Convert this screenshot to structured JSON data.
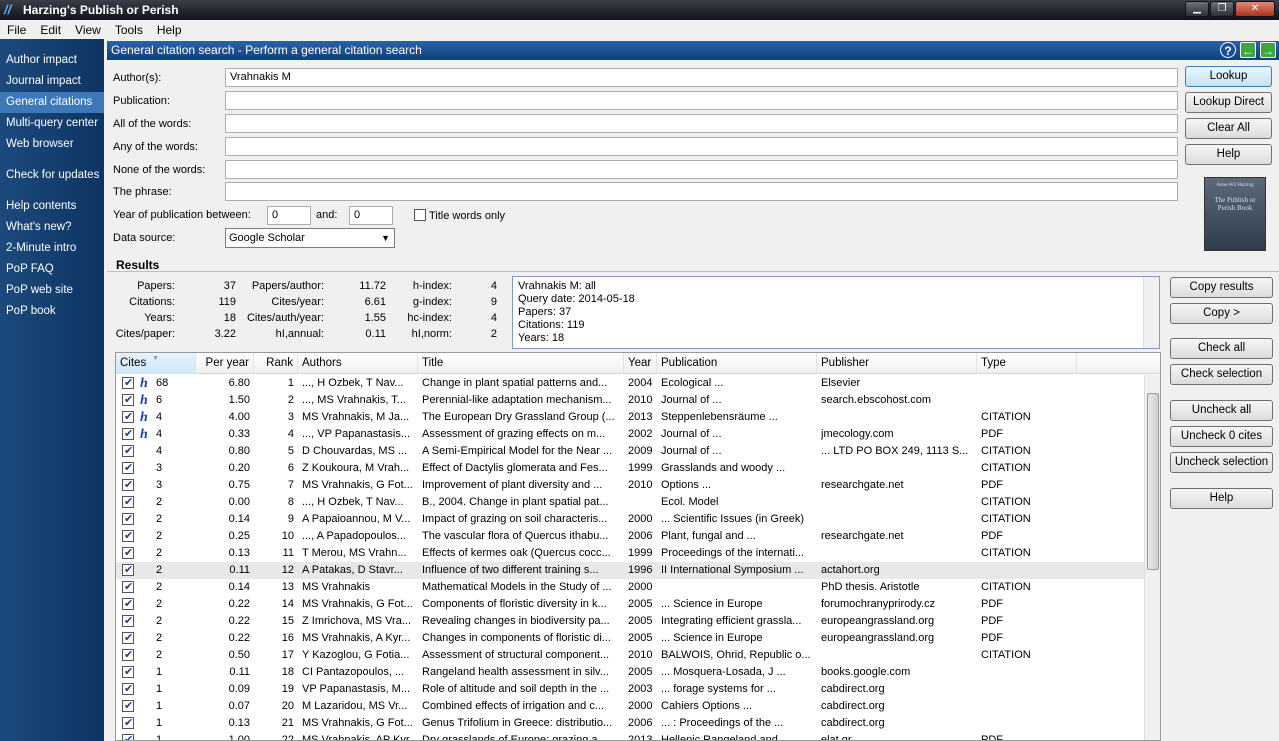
{
  "window": {
    "title": "Harzing's Publish or Perish",
    "min": "▁",
    "max": "❐",
    "close": "✕"
  },
  "menu": [
    "File",
    "Edit",
    "View",
    "Tools",
    "Help"
  ],
  "sidebar": {
    "items": [
      "Author impact",
      "Journal impact",
      "General citations",
      "Multi-query center",
      "Web browser"
    ],
    "updates": "Check for updates",
    "help_items": [
      "Help contents",
      "What's new?",
      "2-Minute intro",
      "PoP FAQ",
      "PoP web site",
      "PoP book"
    ]
  },
  "panel": {
    "title": "General citation search - Perform a general citation search"
  },
  "form": {
    "authors_label": "Author(s):",
    "authors_value": "Vrahnakis M",
    "publication_label": "Publication:",
    "publication_value": "",
    "all_words_label": "All of the words:",
    "all_words_value": "",
    "any_words_label": "Any of the words:",
    "any_words_value": "",
    "none_words_label": "None of the words:",
    "none_words_value": "",
    "phrase_label": "The phrase:",
    "phrase_value": "",
    "year_label": "Year of publication between:",
    "year_from": "0",
    "and_label": "and:",
    "year_to": "0",
    "title_only_label": "Title words only",
    "source_label": "Data source:",
    "source_value": "Google Scholar"
  },
  "buttons": {
    "lookup": "Lookup",
    "lookup_direct": "Lookup Direct",
    "clear_all": "Clear All",
    "help": "Help",
    "copy_results": "Copy results",
    "copy_more": "Copy >",
    "check_all": "Check all",
    "check_selection": "Check selection",
    "uncheck_all": "Uncheck all",
    "uncheck_zero": "Uncheck 0 cites",
    "uncheck_selection": "Uncheck selection",
    "help2": "Help"
  },
  "book": {
    "author": "Anne-Wil Harzing",
    "title": "The Publish or Perish Book"
  },
  "results": {
    "label": "Results",
    "metrics": [
      [
        "Papers:",
        "37",
        "Papers/author:",
        "11.72",
        "h-index:",
        "4"
      ],
      [
        "Citations:",
        "119",
        "Cites/year:",
        "6.61",
        "g-index:",
        "9"
      ],
      [
        "Years:",
        "18",
        "Cites/auth/year:",
        "1.55",
        "hc-index:",
        "4"
      ],
      [
        "Cites/paper:",
        "3.22",
        "hI,annual:",
        "0.11",
        "hI,norm:",
        "2"
      ]
    ],
    "notes": [
      "Vrahnakis M: all",
      "Query date: 2014-05-18",
      "Papers: 37",
      "Citations: 119",
      "Years: 18"
    ]
  },
  "table": {
    "headers": [
      "Cites",
      "Per year",
      "Rank",
      "Authors",
      "Title",
      "Year",
      "Publication",
      "Publisher",
      "Type"
    ],
    "rows": [
      {
        "h": true,
        "cites": "68",
        "per_year": "6.80",
        "rank": "1",
        "authors": "..., H Ozbek, T Nav...",
        "title": "Change in plant spatial patterns and...",
        "year": "2004",
        "publication": "Ecological ...",
        "publisher": "Elsevier",
        "type": ""
      },
      {
        "h": true,
        "cites": "6",
        "per_year": "1.50",
        "rank": "2",
        "authors": "..., MS Vrahnakis, T...",
        "title": "Perennial-like adaptation mechanism...",
        "year": "2010",
        "publication": "Journal of ...",
        "publisher": "search.ebscohost.com",
        "type": ""
      },
      {
        "h": true,
        "cites": "4",
        "per_year": "4.00",
        "rank": "3",
        "authors": "MS Vrahnakis, M Ja...",
        "title": "The European Dry Grassland Group (...",
        "year": "2013",
        "publication": "Steppenlebensräume ...",
        "publisher": "",
        "type": "CITATION"
      },
      {
        "h": true,
        "cites": "4",
        "per_year": "0.33",
        "rank": "4",
        "authors": "..., VP Papanastasis...",
        "title": "Assessment of grazing effects on m...",
        "year": "2002",
        "publication": "Journal of ...",
        "publisher": "jmecology.com",
        "type": "PDF"
      },
      {
        "h": false,
        "cites": "4",
        "per_year": "0.80",
        "rank": "5",
        "authors": "D Chouvardas, MS ...",
        "title": "A Semi-Empirical Model for the Near ...",
        "year": "2009",
        "publication": "Journal of ...",
        "publisher": "... LTD PO BOX 249, 1113 S...",
        "type": "CITATION"
      },
      {
        "h": false,
        "cites": "3",
        "per_year": "0.20",
        "rank": "6",
        "authors": "Z Koukoura, M Vrah...",
        "title": "Effect of Dactylis glomerata and Fes...",
        "year": "1999",
        "publication": "Grasslands and woody ...",
        "publisher": "",
        "type": "CITATION"
      },
      {
        "h": false,
        "cites": "3",
        "per_year": "0.75",
        "rank": "7",
        "authors": "MS Vrahnakis, G Fot...",
        "title": "Improvement of plant diversity and ...",
        "year": "2010",
        "publication": "Options ...",
        "publisher": "researchgate.net",
        "type": "PDF"
      },
      {
        "h": false,
        "cites": "2",
        "per_year": "0.00",
        "rank": "8",
        "authors": "..., H Ozbek, T Nav...",
        "title": "B., 2004. Change in plant spatial pat...",
        "year": "",
        "publication": "Ecol. Model",
        "publisher": "",
        "type": "CITATION"
      },
      {
        "h": false,
        "cites": "2",
        "per_year": "0.14",
        "rank": "9",
        "authors": "A Papaioannou, M V...",
        "title": "Impact of grazing on soil characteris...",
        "year": "2000",
        "publication": "... Scientific Issues (in Greek)",
        "publisher": "",
        "type": "CITATION"
      },
      {
        "h": false,
        "cites": "2",
        "per_year": "0.25",
        "rank": "10",
        "authors": "..., A Papadopoulos...",
        "title": "The vascular flora of Quercus ithabu...",
        "year": "2006",
        "publication": "Plant, fungal and ...",
        "publisher": "researchgate.net",
        "type": "PDF"
      },
      {
        "h": false,
        "cites": "2",
        "per_year": "0.13",
        "rank": "11",
        "authors": "T Merou, MS Vrahn...",
        "title": "Effects of kermes oak (Quercus cocc...",
        "year": "1999",
        "publication": "Proceedings of the internati...",
        "publisher": "",
        "type": "CITATION"
      },
      {
        "h": false,
        "cites": "2",
        "per_year": "0.11",
        "rank": "12",
        "authors": "A Patakas, D Stavr...",
        "title": "Influence of two different training s...",
        "year": "1996",
        "publication": "II International Symposium ...",
        "publisher": "actahort.org",
        "type": "",
        "hl": true
      },
      {
        "h": false,
        "cites": "2",
        "per_year": "0.14",
        "rank": "13",
        "authors": "MS Vrahnakis",
        "title": "Mathematical Models in the Study of ...",
        "year": "2000",
        "publication": "",
        "publisher": "PhD thesis. Aristotle",
        "type": "CITATION"
      },
      {
        "h": false,
        "cites": "2",
        "per_year": "0.22",
        "rank": "14",
        "authors": "MS Vrahnakis, G Fot...",
        "title": "Components of floristic diversity in k...",
        "year": "2005",
        "publication": "... Science in Europe",
        "publisher": "forumochranyprirody.cz",
        "type": "PDF"
      },
      {
        "h": false,
        "cites": "2",
        "per_year": "0.22",
        "rank": "15",
        "authors": "Z Imrichova, MS Vra...",
        "title": "Revealing changes in biodiversity pa...",
        "year": "2005",
        "publication": "Integrating efficient grassla...",
        "publisher": "europeangrassland.org",
        "type": "PDF"
      },
      {
        "h": false,
        "cites": "2",
        "per_year": "0.22",
        "rank": "16",
        "authors": "MS Vrahnakis, A Kyr...",
        "title": "Changes in components of floristic di...",
        "year": "2005",
        "publication": "... Science in Europe",
        "publisher": "europeangrassland.org",
        "type": "PDF"
      },
      {
        "h": false,
        "cites": "2",
        "per_year": "0.50",
        "rank": "17",
        "authors": "Y Kazoglou, G Fotia...",
        "title": "Assessment of structural component...",
        "year": "2010",
        "publication": "BALWOIS, Ohrid, Republic o...",
        "publisher": "",
        "type": "CITATION"
      },
      {
        "h": false,
        "cites": "1",
        "per_year": "0.11",
        "rank": "18",
        "authors": "CI Pantazopoulos, ...",
        "title": "Rangeland health assessment in silv...",
        "year": "2005",
        "publication": "... Mosquera-Losada, J ...",
        "publisher": "books.google.com",
        "type": ""
      },
      {
        "h": false,
        "cites": "1",
        "per_year": "0.09",
        "rank": "19",
        "authors": "VP Papanastasis, M...",
        "title": "Role of altitude and soil depth in the ...",
        "year": "2003",
        "publication": "... forage systems for ...",
        "publisher": "cabdirect.org",
        "type": ""
      },
      {
        "h": false,
        "cites": "1",
        "per_year": "0.07",
        "rank": "20",
        "authors": "M Lazaridou, MS Vr...",
        "title": "Combined effects of irrigation and c...",
        "year": "2000",
        "publication": "Cahiers Options ...",
        "publisher": "cabdirect.org",
        "type": ""
      },
      {
        "h": false,
        "cites": "1",
        "per_year": "0.13",
        "rank": "21",
        "authors": "MS Vrahnakis, G Fot...",
        "title": "Genus Trifolium in Greece: distributio...",
        "year": "2006",
        "publication": "... : Proceedings of the ...",
        "publisher": "cabdirect.org",
        "type": ""
      },
      {
        "h": false,
        "cites": "1",
        "per_year": "1.00",
        "rank": "22",
        "authors": "MS Vrahnakis, AP Kyr...",
        "title": "Dry grasslands of Europe: grazing a...",
        "year": "2013",
        "publication": "Hellenic Rangeland and ...",
        "publisher": "elat.gr",
        "type": "PDF"
      }
    ]
  }
}
